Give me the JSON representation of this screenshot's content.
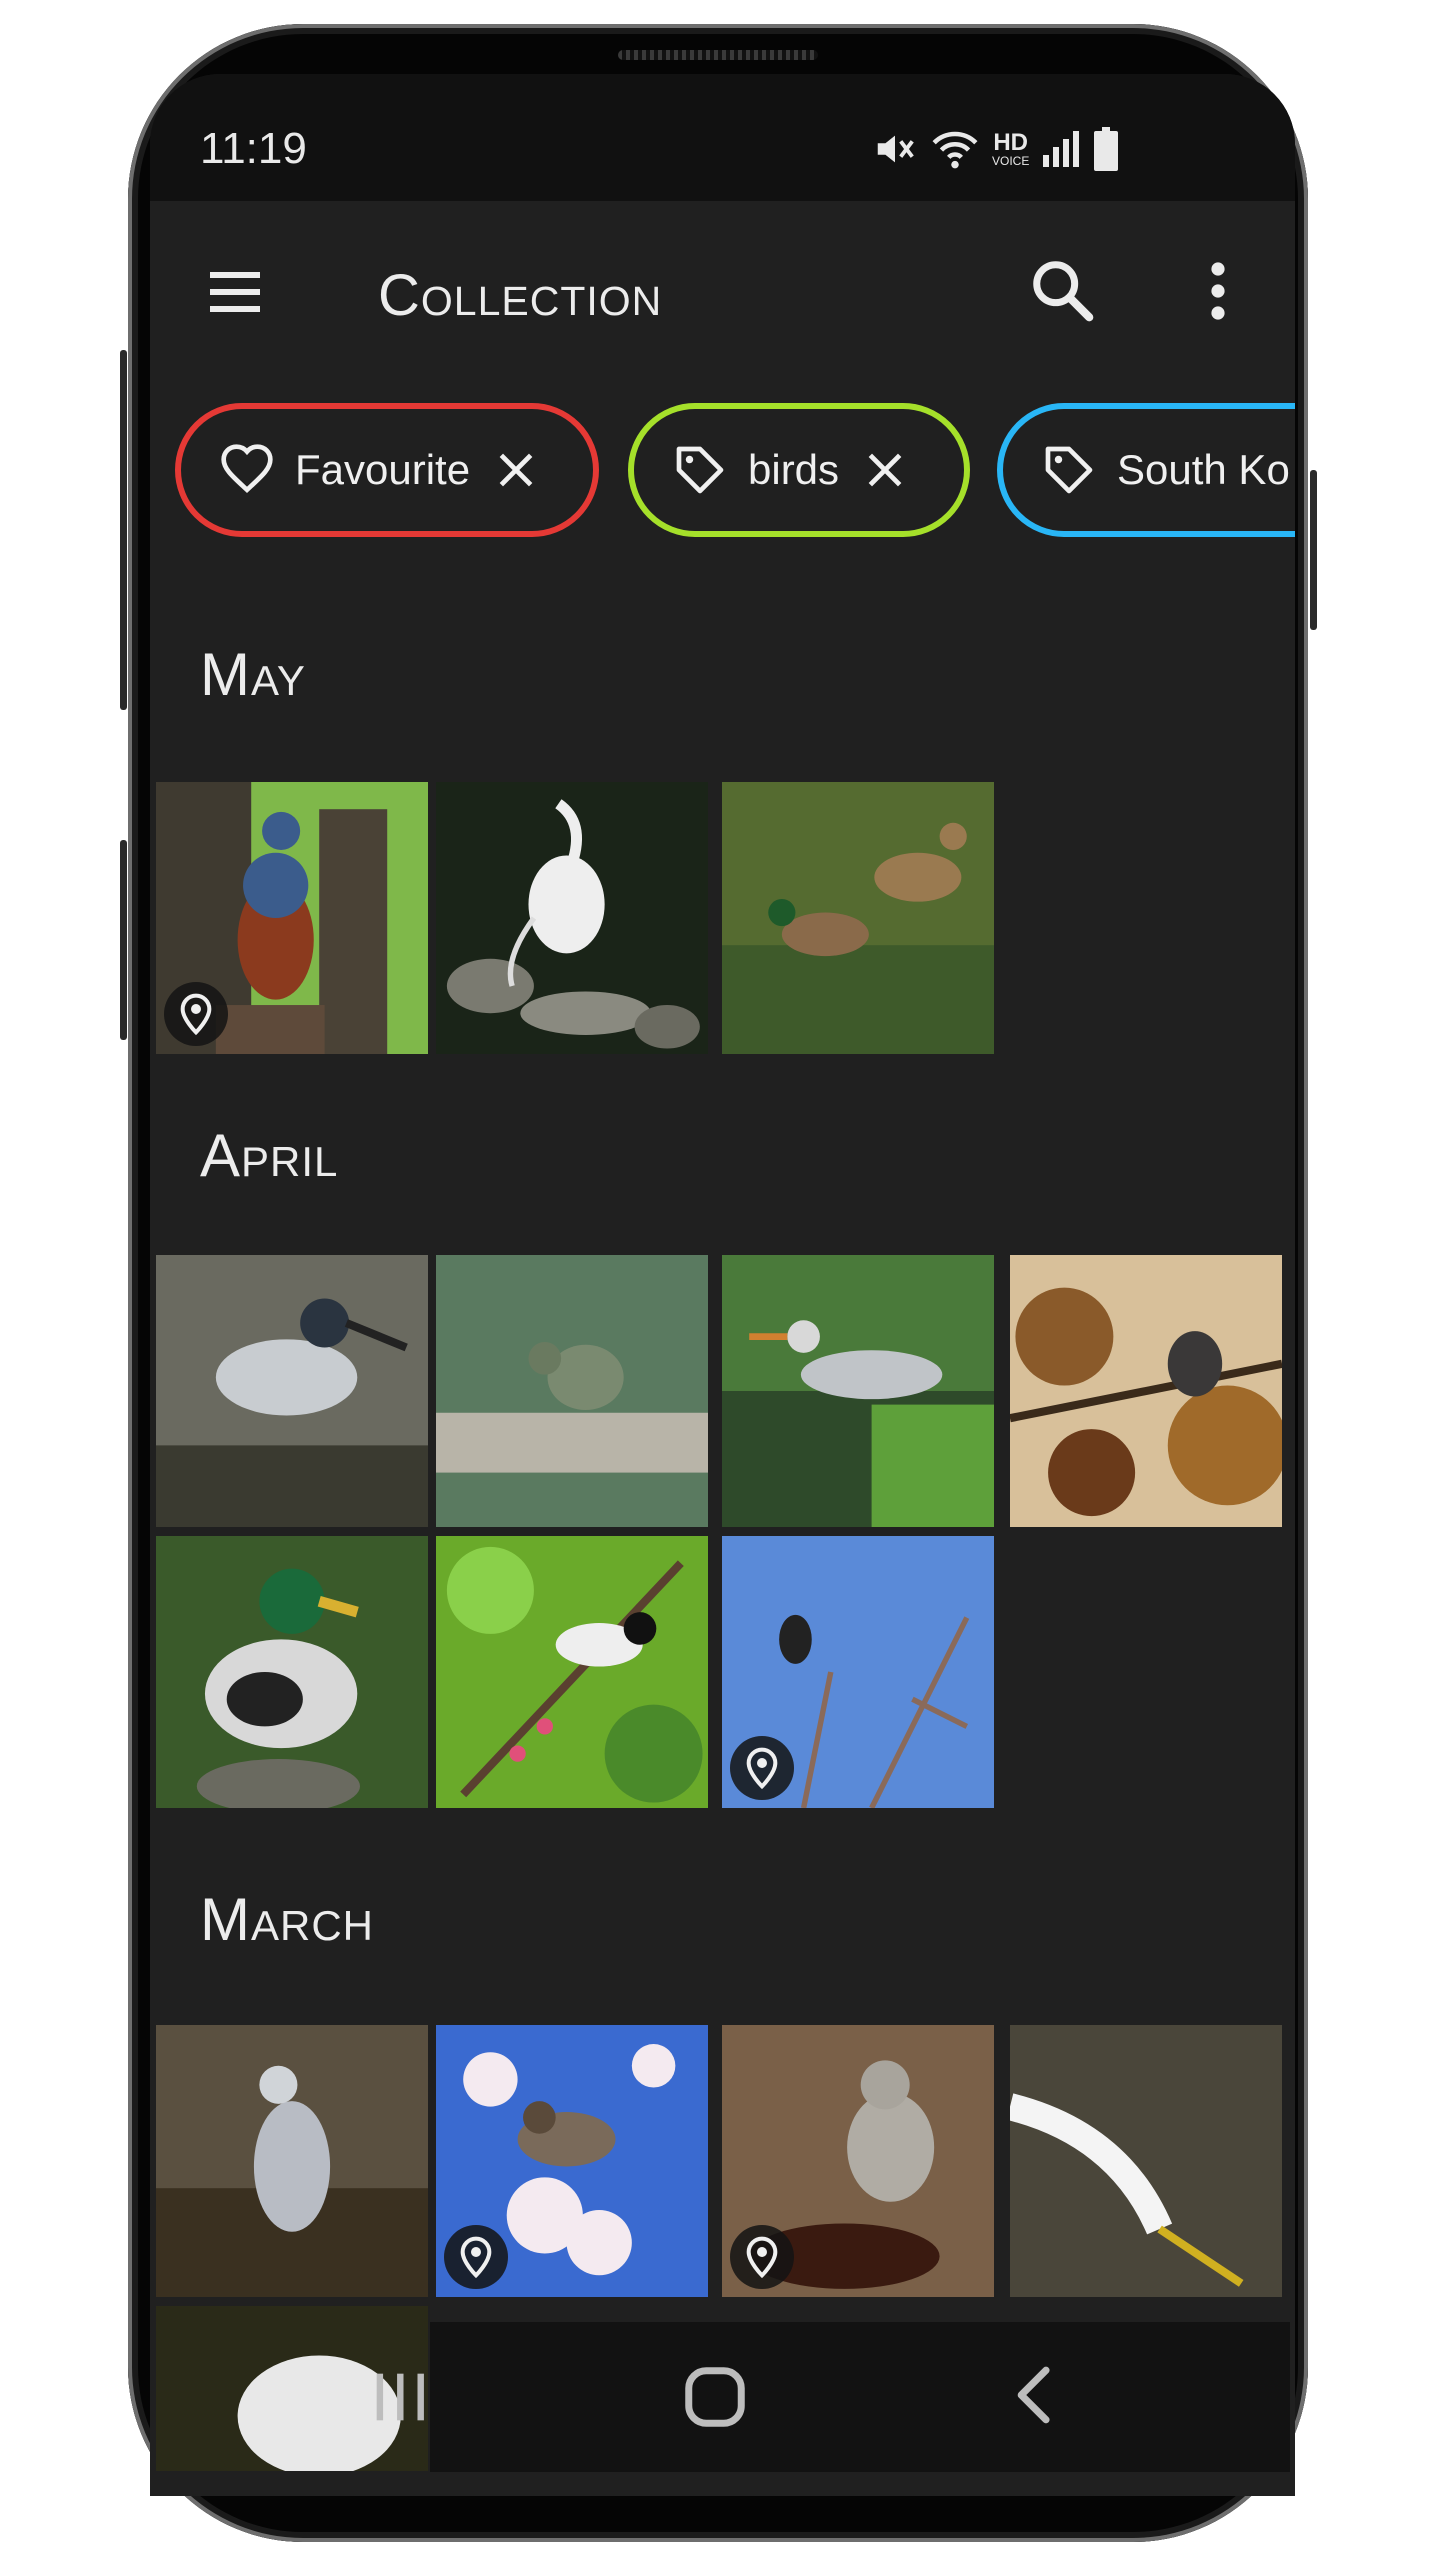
{
  "status_bar": {
    "time": "11:19",
    "hd_label": "HD",
    "voice_label": "VOICE",
    "icons": [
      "mute-icon",
      "wifi-icon",
      "hd-voice-icon",
      "signal-icon",
      "battery-icon"
    ]
  },
  "app_bar": {
    "title": "Collection",
    "icons": [
      "menu-icon",
      "search-icon",
      "more-vert-icon"
    ]
  },
  "filter_chips": [
    {
      "label": "Favourite",
      "icon": "heart-icon",
      "color": "#e53935",
      "removable": true
    },
    {
      "label": "birds",
      "icon": "tag-icon",
      "color": "#a5e02a",
      "removable": true
    },
    {
      "label": "South Ko",
      "icon": "tag-icon",
      "color": "#29b6f6",
      "removable": false
    }
  ],
  "sections": [
    {
      "title": "May",
      "items": [
        "blue rock thrush",
        "great egret",
        "mallards"
      ]
    },
    {
      "title": "April",
      "items": [
        "night heron",
        "kingfisher",
        "grey heron",
        "bird on branch",
        "mallard drake",
        "tit on blossom",
        "bird on branch, blue sky"
      ]
    },
    {
      "title": "March",
      "items": [
        "heron",
        "bulbul in blossom",
        "hawk",
        "egret",
        "egret"
      ]
    }
  ],
  "nav_bar": {
    "icons": [
      "recents-icon",
      "home-icon",
      "back-icon"
    ]
  }
}
